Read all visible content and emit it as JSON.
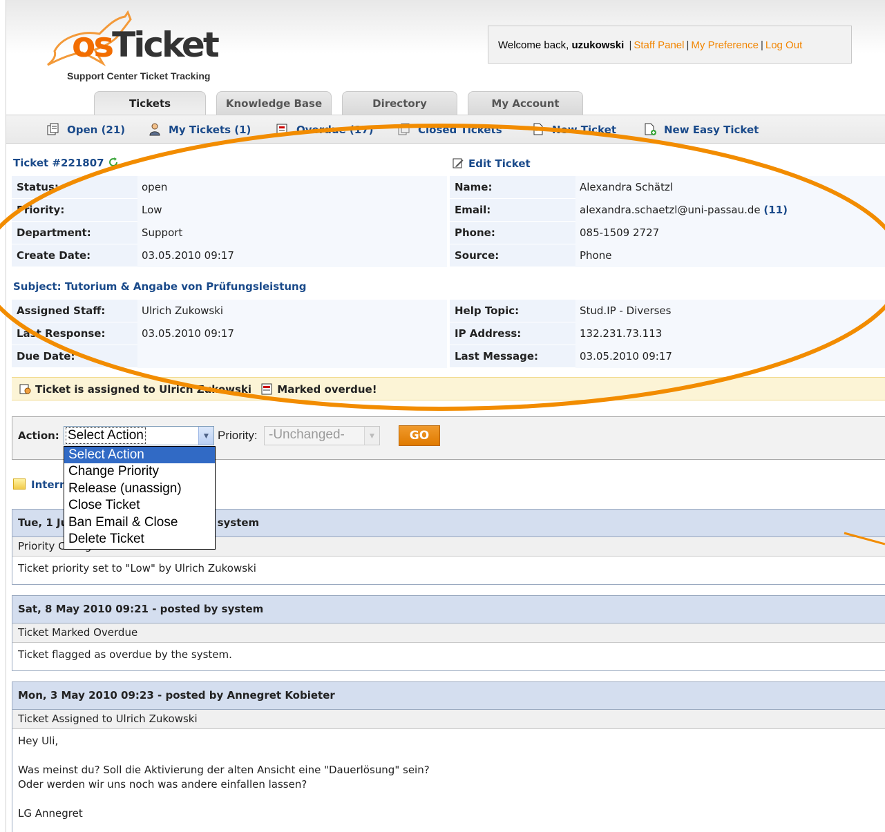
{
  "header": {
    "logo_word_os": "os",
    "logo_word_ticket": "Ticket",
    "logo_tagline": "Support Center Ticket Tracking",
    "welcome_prefix": "Welcome back,",
    "username": "uzukowski",
    "links": [
      "Staff Panel",
      "My Preference",
      "Log Out"
    ],
    "separator": "|"
  },
  "tabs": [
    {
      "label": "Tickets",
      "active": true
    },
    {
      "label": "Knowledge Base",
      "active": false
    },
    {
      "label": "Directory",
      "active": false
    },
    {
      "label": "My Account",
      "active": false
    }
  ],
  "subnav": [
    {
      "label": "Open (21)",
      "icon": "open-tickets-icon"
    },
    {
      "label": "My Tickets (1)",
      "icon": "my-tickets-icon"
    },
    {
      "label": "Overdue (17)",
      "icon": "overdue-icon"
    },
    {
      "label": "Closed Tickets",
      "icon": "closed-tickets-icon"
    },
    {
      "label": "New Ticket",
      "icon": "new-ticket-icon"
    },
    {
      "label": "New Easy Ticket",
      "icon": "new-easy-ticket-icon"
    }
  ],
  "ticket": {
    "number_label": "Ticket #221807",
    "edit_label": "Edit Ticket",
    "left": [
      {
        "label": "Status:",
        "value": "open"
      },
      {
        "label": "Priority:",
        "value": "Low"
      },
      {
        "label": "Department:",
        "value": "Support"
      },
      {
        "label": "Create Date:",
        "value": "03.05.2010 09:17"
      }
    ],
    "right": [
      {
        "label": "Name:",
        "value": "Alexandra Schätzl"
      },
      {
        "label": "Email:",
        "value": "alexandra.schaetzl@uni-passau.de",
        "count": "(11)"
      },
      {
        "label": "Phone:",
        "value": "085-1509 2727"
      },
      {
        "label": "Source:",
        "value": "Phone"
      }
    ],
    "subject": "Subject: Tutorium & Angabe von Prüfungsleistung",
    "left2": [
      {
        "label": "Assigned Staff:",
        "value": "Ulrich Zukowski"
      },
      {
        "label": "Last Response:",
        "value": "03.05.2010 09:17"
      },
      {
        "label": "Due Date:",
        "value": ""
      }
    ],
    "right2": [
      {
        "label": "Help Topic:",
        "value": "Stud.IP - Diverses"
      },
      {
        "label": "IP Address:",
        "value": "132.231.73.113"
      },
      {
        "label": "Last Message:",
        "value": "03.05.2010 09:17"
      }
    ]
  },
  "notice": {
    "assigned": "Ticket is assigned to Ulrich Zukowski",
    "overdue": "Marked overdue!"
  },
  "action_bar": {
    "action_label": "Action:",
    "action_value": "Select Action",
    "priority_label": "Priority:",
    "priority_value": "-Unchanged-",
    "go_label": "GO",
    "options": [
      "Select Action",
      "Change Priority",
      "Release (unassign)",
      "Close Ticket",
      "Ban Email & Close",
      "Delete Ticket"
    ]
  },
  "internal_notes_label": "Internal Notes",
  "entries": [
    {
      "header": "Tue, 1 Jun 2010 09:12 -  posted by system",
      "title": "Priority Changed",
      "body": [
        "Ticket priority set to \"Low\" by Ulrich Zukowski"
      ]
    },
    {
      "header": "Sat, 8 May 2010 09:21 -  posted by system",
      "title": "Ticket Marked Overdue",
      "body": [
        "Ticket flagged as overdue by the system."
      ]
    },
    {
      "header": "Mon, 3 May 2010 09:23 -  posted by Annegret Kobieter",
      "title": "Ticket Assigned to Ulrich Zukowski",
      "body": [
        "Hey Uli,",
        "",
        "Was meinst du? Soll die Aktivierung der alten Ansicht eine \"Dauerlösung\" sein?",
        "Oder werden wir uns noch was andere einfallen lassen?",
        "",
        "LG Annegret"
      ]
    }
  ],
  "colors": {
    "brand_orange": "#f28500",
    "link_blue": "#1a4a8a",
    "row_blue": "#eef3fb",
    "entry_header": "#d4deef",
    "annotation": "#f28c00"
  }
}
